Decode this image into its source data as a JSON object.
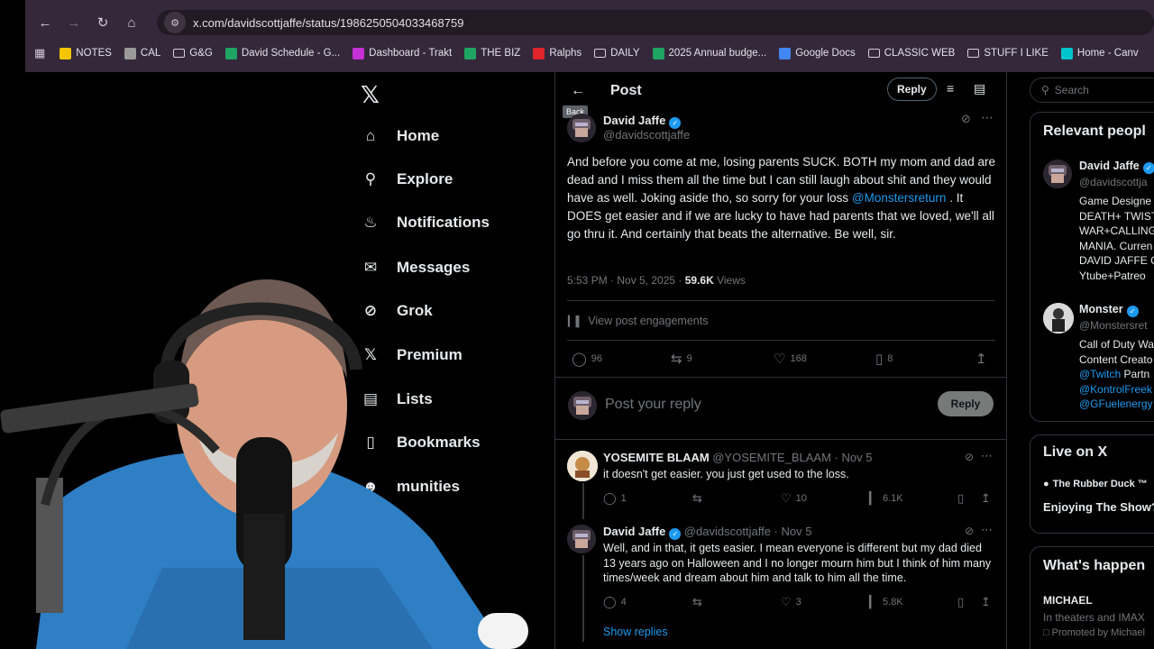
{
  "browser": {
    "url": "x.com/davidscottjaffe/status/1986250504033468759",
    "bookmarks": [
      {
        "label": "NOTES",
        "color": "#f5c400"
      },
      {
        "label": "CAL",
        "color": "#9a9a9a"
      },
      {
        "label": "G&G",
        "color": "folder"
      },
      {
        "label": "David Schedule - G...",
        "color": "#1fa463"
      },
      {
        "label": "Dashboard - Trakt",
        "color": "#c531d6"
      },
      {
        "label": "THE BIZ",
        "color": "#1fa463"
      },
      {
        "label": "Ralphs",
        "color": "#e0242c"
      },
      {
        "label": "DAILY",
        "color": "folder"
      },
      {
        "label": "2025 Annual budge...",
        "color": "#1fa463"
      },
      {
        "label": "Google Docs",
        "color": "#4285f4"
      },
      {
        "label": "CLASSIC WEB",
        "color": "folder"
      },
      {
        "label": "STUFF I LIKE",
        "color": "folder"
      },
      {
        "label": "Home - Canv",
        "color": "#00c4cc"
      }
    ]
  },
  "nav": {
    "items": [
      {
        "label": "Home",
        "icon": "home-icon"
      },
      {
        "label": "Explore",
        "icon": "search-icon"
      },
      {
        "label": "Notifications",
        "icon": "bell-icon"
      },
      {
        "label": "Messages",
        "icon": "mail-icon"
      },
      {
        "label": "Grok",
        "icon": "grok-icon"
      },
      {
        "label": "Premium",
        "icon": "x-icon"
      },
      {
        "label": "Lists",
        "icon": "list-icon"
      },
      {
        "label": "Bookmarks",
        "icon": "bookmark-icon"
      },
      {
        "label": "munities",
        "icon": "communities-icon"
      }
    ]
  },
  "header": {
    "title": "Post",
    "back_tooltip": "Back",
    "reply_label": "Reply"
  },
  "post": {
    "author_name": "David Jaffe",
    "author_handle": "@davidscottjaffe",
    "text_before_mention": "And before you come at me, losing parents SUCK. BOTH my mom and dad are dead and I miss them all the time but I can still laugh about shit and they would have as well. Joking aside tho, so sorry for your loss",
    "mention": "@Monstersreturn",
    "text_after_mention": ". It DOES get easier and if we are lucky to have had parents that we loved, we'll all go thru it. And certainly that beats the alternative. Be well, sir.",
    "timestamp": "5:53 PM · Nov 5, 2025 · ",
    "views_count": "59.6K",
    "views_label": " Views",
    "engagements_label": "View post engagements",
    "replies": "96",
    "reposts": "9",
    "likes": "168",
    "bookmarks": "8"
  },
  "composer": {
    "placeholder": "Post your reply",
    "button": "Reply"
  },
  "replies": [
    {
      "name": "YOSEMITE BLAAM",
      "handle": "@YOSEMITE_BLAAM",
      "date": " · Nov 5",
      "text": "it doesn't get easier. you just get used to the loss.",
      "replies": "1",
      "reposts": "",
      "likes": "10",
      "views": "6.1K"
    },
    {
      "name": "David Jaffe",
      "handle": "@davidscottjaffe",
      "date": " · Nov 5",
      "text": "Well, and in that, it gets easier. I mean everyone is different but my dad died 13 years ago on Halloween and I no longer mourn him but I think of him many times/week and dream about him and talk to him all the time.",
      "replies": "4",
      "reposts": "",
      "likes": "3",
      "views": "5.8K"
    }
  ],
  "show_replies": "Show replies",
  "right": {
    "search_placeholder": "Search",
    "relevant_title": "Relevant peopl",
    "people": [
      {
        "name": "David Jaffe",
        "handle": "@davidscottja",
        "bio": [
          "Game Designe",
          "DEATH+ TWIST",
          "WAR+CALLING",
          "MANIA. Curren",
          "DAVID JAFFE G",
          "Ytube+Patreo"
        ]
      },
      {
        "name": "Monster",
        "handle": "@Monstersret",
        "bio": [
          "Call of Duty Wa",
          "Content Creato"
        ],
        "links": [
          "@Twitch",
          "@KontrolFreek",
          "@GFuelenergy"
        ],
        "link_suffix": [
          " Partn",
          "",
          ""
        ]
      }
    ],
    "live_title": "Live on X",
    "live_host": "The Rubber Duck ™",
    "live_show": "Enjoying The Show?",
    "happening_title": "What's happen",
    "trend_name": "MICHAEL",
    "trend_desc": "In theaters and IMAX",
    "trend_promo": "Promoted by Michael"
  }
}
